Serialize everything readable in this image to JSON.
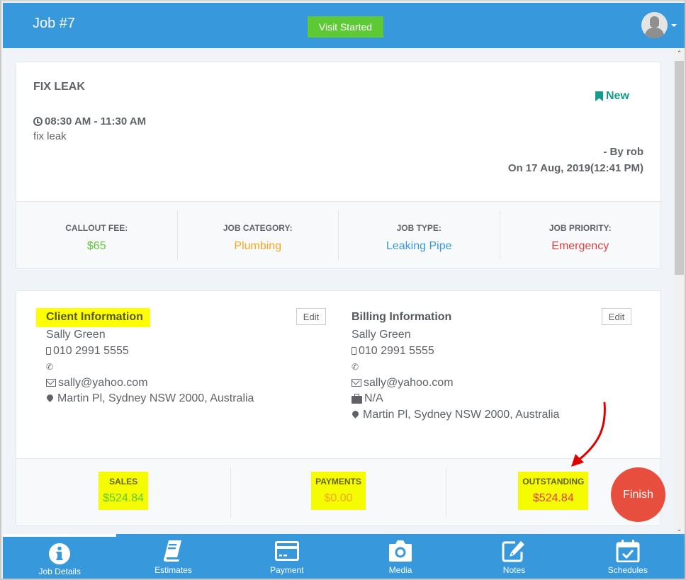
{
  "header": {
    "title": "Job #7",
    "visit_button": "Visit Started",
    "user_menu_icon": "user-avatar-icon"
  },
  "job": {
    "name": "FIX LEAK",
    "status": "New",
    "status_color": "#139b8b",
    "time": "08:30 AM - 11:30 AM",
    "description": "fix leak",
    "created_by": "- By rob",
    "created_on": "On 17 Aug, 2019(12:41 PM)"
  },
  "stats": [
    {
      "label": "CALLOUT FEE:",
      "value": "$65",
      "color": "#5dc935"
    },
    {
      "label": "JOB CATEGORY:",
      "value": "Plumbing",
      "color": "#f5a623"
    },
    {
      "label": "JOB TYPE:",
      "value": "Leaking Pipe",
      "color": "#3898dc"
    },
    {
      "label": "JOB PRIORITY:",
      "value": "Emergency",
      "color": "#e04040"
    }
  ],
  "client": {
    "title": "Client Information",
    "edit_label": "Edit",
    "name": "Sally Green",
    "mobile": "010 2991 5555",
    "phone": "",
    "email": "sally@yahoo.com",
    "address": "Martin Pl, Sydney NSW 2000, Australia"
  },
  "billing": {
    "title": "Billing Information",
    "edit_label": "Edit",
    "name": "Sally Green",
    "mobile": "010 2991 5555",
    "phone": "",
    "email": "sally@yahoo.com",
    "company": "N/A",
    "address": "Martin Pl, Sydney NSW 2000, Australia"
  },
  "totals": [
    {
      "label": "SALES",
      "value": "$524.84",
      "color": "#5dc935"
    },
    {
      "label": "PAYMENTS",
      "value": "$0.00",
      "color": "#f5a623"
    },
    {
      "label": "OUTSTANDING",
      "value": "$524.84",
      "color": "#e04040"
    }
  ],
  "finish_button": "Finish",
  "annotation_color": "#e00000",
  "bottom_nav": [
    {
      "label": "Job Details",
      "icon": "info-icon",
      "active": true
    },
    {
      "label": "Estimates",
      "icon": "book-icon",
      "active": false
    },
    {
      "label": "Payment",
      "icon": "credit-card-icon",
      "active": false
    },
    {
      "label": "Media",
      "icon": "camera-icon",
      "active": false
    },
    {
      "label": "Notes",
      "icon": "edit-note-icon",
      "active": false
    },
    {
      "label": "Schedules",
      "icon": "calendar-check-icon",
      "active": false
    }
  ]
}
